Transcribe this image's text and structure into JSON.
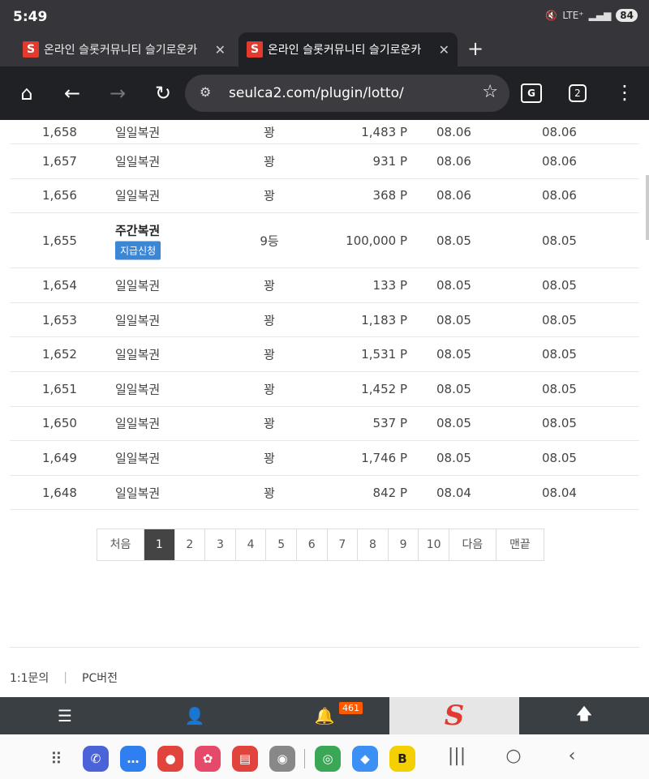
{
  "status_bar": {
    "time": "5:49",
    "network": "LTE⁺",
    "battery": "84"
  },
  "tabs": [
    {
      "title": "온라인 슬롯커뮤니티 슬기로운카",
      "favicon": "S"
    },
    {
      "title": "온라인 슬롯커뮤니티 슬기로운카",
      "favicon": "S"
    }
  ],
  "new_tab_label": "+",
  "address_bar": {
    "url": "seulca2.com/plugin/lotto/",
    "tab_count": "2"
  },
  "icons": {
    "home": "home-icon",
    "back": "back-arrow-icon",
    "forward": "forward-arrow-icon",
    "reload": "reload-icon",
    "site_settings": "tune-icon",
    "bookmark": "star-icon",
    "translate": "translate-icon",
    "menu": "more-vert-icon"
  },
  "lotto_rows": [
    {
      "num": "1,658",
      "type": "일일복권",
      "result": "꽝",
      "points": "1,483 P",
      "date1": "08.06",
      "date2": "08.06"
    },
    {
      "num": "1,657",
      "type": "일일복권",
      "result": "꽝",
      "points": "931 P",
      "date1": "08.06",
      "date2": "08.06"
    },
    {
      "num": "1,656",
      "type": "일일복권",
      "result": "꽝",
      "points": "368 P",
      "date1": "08.06",
      "date2": "08.06"
    },
    {
      "num": "1,655",
      "type": "주간복권",
      "claim": "지급신청",
      "result": "9등",
      "points": "100,000 P",
      "date1": "08.05",
      "date2": "08.05"
    },
    {
      "num": "1,654",
      "type": "일일복권",
      "result": "꽝",
      "points": "133 P",
      "date1": "08.05",
      "date2": "08.05"
    },
    {
      "num": "1,653",
      "type": "일일복권",
      "result": "꽝",
      "points": "1,183 P",
      "date1": "08.05",
      "date2": "08.05"
    },
    {
      "num": "1,652",
      "type": "일일복권",
      "result": "꽝",
      "points": "1,531 P",
      "date1": "08.05",
      "date2": "08.05"
    },
    {
      "num": "1,651",
      "type": "일일복권",
      "result": "꽝",
      "points": "1,452 P",
      "date1": "08.05",
      "date2": "08.05"
    },
    {
      "num": "1,650",
      "type": "일일복권",
      "result": "꽝",
      "points": "537 P",
      "date1": "08.05",
      "date2": "08.05"
    },
    {
      "num": "1,649",
      "type": "일일복권",
      "result": "꽝",
      "points": "1,746 P",
      "date1": "08.05",
      "date2": "08.05"
    },
    {
      "num": "1,648",
      "type": "일일복권",
      "result": "꽝",
      "points": "842 P",
      "date1": "08.04",
      "date2": "08.04"
    }
  ],
  "pagination": {
    "first": "처음",
    "pages": [
      "1",
      "2",
      "3",
      "4",
      "5",
      "6",
      "7",
      "8",
      "9",
      "10"
    ],
    "active_page": "1",
    "next": "다음",
    "last": "맨끝"
  },
  "footer": {
    "inquiry": "1:1문의",
    "pc_version": "PC버전"
  },
  "site_nav": {
    "notification_count": "461",
    "brand": "S"
  },
  "colors": {
    "claim_button": "#3b87d6",
    "badge": "#ff5a00",
    "brand_red": "#e23a2e",
    "site_nav_bg": "#3a3f44",
    "active_page_bg": "#444444"
  },
  "dock_apps": [
    {
      "name": "phone-app-icon",
      "color": "#4a63d8",
      "glyph": "✆"
    },
    {
      "name": "messages-app-icon",
      "color": "#2f7ff0",
      "glyph": "…"
    },
    {
      "name": "person-app-icon",
      "color": "#e0443c",
      "glyph": "●"
    },
    {
      "name": "gallery-app-icon",
      "color": "#e64a6a",
      "glyph": "✿"
    },
    {
      "name": "notes-app-icon",
      "color": "#e0443c",
      "glyph": "▤"
    },
    {
      "name": "camera-app-icon",
      "color": "#888888",
      "glyph": "◉"
    },
    {
      "name": "chrome-app-icon",
      "color": "#3aa757",
      "glyph": "◎"
    },
    {
      "name": "chat-app-icon",
      "color": "#3b8ff5",
      "glyph": "◆"
    },
    {
      "name": "b-app-icon",
      "color": "#f5d000",
      "glyph": "B"
    }
  ]
}
